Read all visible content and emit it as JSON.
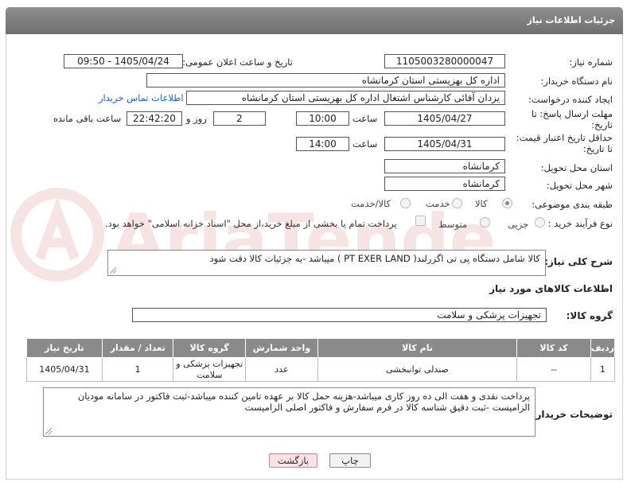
{
  "header": {
    "title": "جزئیات اطلاعات نیاز"
  },
  "fields": {
    "need_number_label": "شماره نیاز:",
    "need_number": "1105003280000047",
    "announce_label": "تاریخ و ساعت اعلان عمومی:",
    "announce_value": "1405/04/24 - 09:50",
    "buyer_org_label": "نام دستگاه خریدار:",
    "buyer_org": "اداره کل بهزیستی استان کرمانشاه",
    "creator_label": "ایجاد کننده درخواست:",
    "creator": "یزدان آقائی کارشناس اشتغال  اداره کل بهزیستی استان کرمانشاه",
    "contact_link": "اطلاعات تماس خریدار",
    "deadline_label_1": "مهلت ارسال پاسخ: تا",
    "deadline_label_2": "تاریخ:",
    "deadline_date": "1405/04/27",
    "time_label": "ساعت",
    "deadline_time": "10:00",
    "days_value": "2",
    "days_label": "روز و",
    "remaining_time": "22:42:20",
    "remaining_label": "ساعت باقی مانده",
    "price_label_1": "حداقل تاریخ اعتبار قیمت:",
    "price_label_2": "تا تاریخ:",
    "price_date": "1405/04/31",
    "price_time": "14:00",
    "province_label": "استان محل تحویل:",
    "province": "کرمانشاه",
    "city_label": "شهر محل تحویل:",
    "city": "کرمانشاه",
    "category_label": "طبقه بندی موضوعی:",
    "category_options": [
      "کالا",
      "خدمت",
      "کالا/خدمت"
    ],
    "process_label": "نوع فرآیند خرید :",
    "process_options": [
      "جزیی",
      "متوسط"
    ],
    "payment_note": "پرداخت تمام یا بخشی از مبلغ خرید،از محل \"اسناد خزانه اسلامی\" خواهد بود."
  },
  "description": {
    "label": "شرح کلی نیاز:",
    "text": "کالا شامل دستگاه پی تی اگزرلند( PT EXER LAND ) میباشد -به جزئیات کالا دقت شود"
  },
  "goods": {
    "section_title": "اطلاعات کالاهای مورد نیاز",
    "group_label": "گروه کالا:",
    "group_value": "تجهیزات پزشکی و سلامت",
    "columns": [
      "ردیف",
      "کد کالا",
      "نام کالا",
      "واحد شمارش",
      "گروه کالا",
      "تعداد / مقدار",
      "تاریخ نیاز"
    ],
    "rows": [
      [
        "1",
        "--",
        "صندلی توانبخشی",
        "عدد",
        "تجهیزات پزشکی و سلامت",
        "1",
        "1405/04/31"
      ]
    ]
  },
  "buyer_notes": {
    "label": "توضیحات خریدار:",
    "text": "پرداخت نقدی و هفت الی ده روز کاری میباشد-هزینه حمل کالا بر عهده تامین کننده میباشد-ثبت فاکتور در سامانه مودیان الزامیست -ثبت دقیق شناسه کالا در فرم سفارش و فاکتور اصلی الزامیست"
  },
  "buttons": {
    "print": "چاپ",
    "back": "بازگشت"
  },
  "watermark": "AriaTender.net",
  "colors": {
    "header": "#7f7f7f",
    "link": "#1b5fb8",
    "back_button": "#fde3e3"
  }
}
